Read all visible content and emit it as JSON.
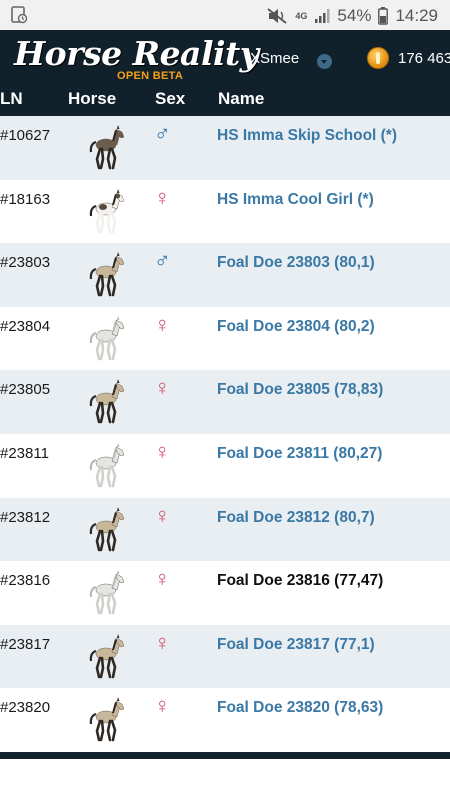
{
  "status_bar": {
    "battery": "54%",
    "time": "14:29",
    "network": "4G"
  },
  "header": {
    "logo_text": "Horse Reality",
    "logo_subtitle": "OPEN BETA",
    "username": "XSmee",
    "currency": "176 463"
  },
  "table": {
    "headers": {
      "ln": "LN",
      "horse": "Horse",
      "sex": "Sex",
      "name": "Name"
    },
    "rows": [
      {
        "ln": "#10627",
        "sex": "♂",
        "sex_type": "male",
        "name": "HS Imma Skip School (*)",
        "coat": "dark"
      },
      {
        "ln": "#18163",
        "sex": "♀",
        "sex_type": "female",
        "name": "HS Imma Cool Girl (*)",
        "coat": "pinto"
      },
      {
        "ln": "#23803",
        "sex": "♂",
        "sex_type": "male",
        "name": "Foal Doe 23803 (80,1)",
        "coat": "buckskin"
      },
      {
        "ln": "#23804",
        "sex": "♀",
        "sex_type": "female",
        "name": "Foal Doe 23804 (80,2)",
        "coat": "grey"
      },
      {
        "ln": "#23805",
        "sex": "♀",
        "sex_type": "female",
        "name": "Foal Doe 23805 (78,83)",
        "coat": "buckskin"
      },
      {
        "ln": "#23811",
        "sex": "♀",
        "sex_type": "female",
        "name": "Foal Doe 23811 (80,27)",
        "coat": "grey"
      },
      {
        "ln": "#23812",
        "sex": "♀",
        "sex_type": "female",
        "name": "Foal Doe 23812 (80,7)",
        "coat": "buckskin"
      },
      {
        "ln": "#23816",
        "sex": "♀",
        "sex_type": "female",
        "name": "Foal Doe 23816 (77,47)",
        "coat": "grey",
        "current": true
      },
      {
        "ln": "#23817",
        "sex": "♀",
        "sex_type": "female",
        "name": "Foal Doe 23817 (77,1)",
        "coat": "buckskin"
      },
      {
        "ln": "#23820",
        "sex": "♀",
        "sex_type": "female",
        "name": "Foal Doe 23820 (78,63)",
        "coat": "buckskin"
      }
    ]
  },
  "colors": {
    "header_bg": "#11212c",
    "link": "#3a78a5",
    "row_alt": "#e9eef2",
    "male": "#2a6ea8",
    "female": "#d05070",
    "logo_accent": "#f4a21a"
  },
  "coat_colors": {
    "dark": {
      "body": "#6b5c4e",
      "mane": "#2e2620",
      "legs": "#2e2620",
      "patch": null
    },
    "pinto": {
      "body": "#f3f1ee",
      "mane": "#2e2620",
      "legs": "#f3f1ee",
      "patch": "#5a4a3e"
    },
    "buckskin": {
      "body": "#c9b79b",
      "mane": "#2f2924",
      "legs": "#2f2924",
      "patch": null
    },
    "grey": {
      "body": "#e4e4e2",
      "mane": "#b8b8b4",
      "legs": "#cfcfcb",
      "patch": null
    }
  }
}
